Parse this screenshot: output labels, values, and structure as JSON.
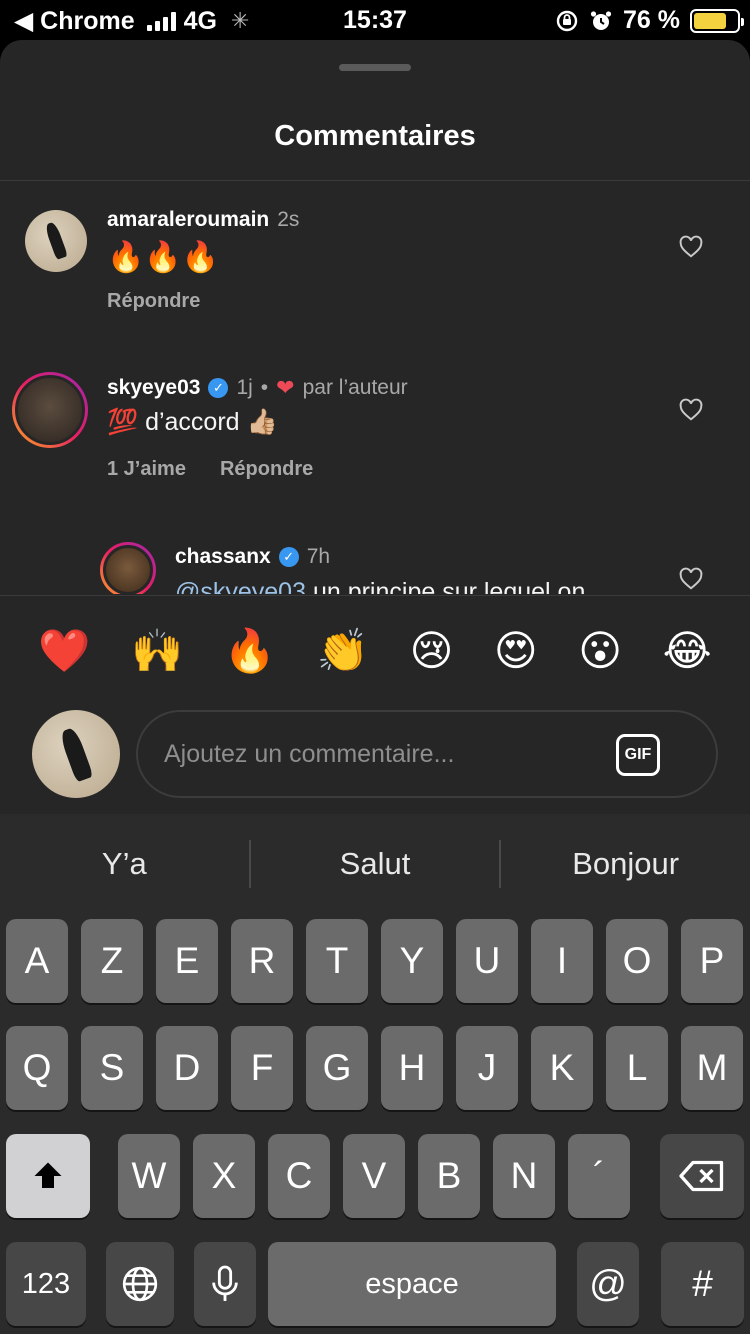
{
  "status_bar": {
    "back_label": "◀ Chrome",
    "network": "4G",
    "time": "15:37",
    "battery_percent": "76 %",
    "battery_level": 0.76,
    "battery_color": "#f4d13f"
  },
  "sheet": {
    "title": "Commentaires"
  },
  "comments": [
    {
      "username": "amaraleroumain",
      "time": "2s",
      "text": "🔥🔥🔥",
      "reply_label": "Répondre",
      "likes_label": ""
    },
    {
      "username": "skyeye03",
      "verified": true,
      "time": "1j",
      "separator": "•",
      "liked_by_author_label": "par l’auteur",
      "text": "💯 d’accord 👍🏼",
      "likes_label": "1 J’aime",
      "reply_label": "Répondre"
    },
    {
      "username": "chassanx",
      "verified": true,
      "time": "7h",
      "mention": "@skyeye03",
      "text": " un principe sur lequel on"
    }
  ],
  "emoji_bar": [
    "❤️",
    "🙌",
    "🔥",
    "👏",
    "😢",
    "😍",
    "😮",
    "😂"
  ],
  "composer": {
    "placeholder": "Ajoutez un commentaire...",
    "gif_label": "GIF"
  },
  "keyboard": {
    "suggestions": [
      "Y’a",
      "Salut",
      "Bonjour"
    ],
    "row1": [
      "A",
      "Z",
      "E",
      "R",
      "T",
      "Y",
      "U",
      "I",
      "O",
      "P"
    ],
    "row2": [
      "Q",
      "S",
      "D",
      "F",
      "G",
      "H",
      "J",
      "K",
      "L",
      "M"
    ],
    "row3": [
      "W",
      "X",
      "C",
      "V",
      "B",
      "N",
      "´"
    ],
    "numbers_label": "123",
    "space_label": "espace",
    "at_label": "@",
    "hash_label": "#"
  }
}
